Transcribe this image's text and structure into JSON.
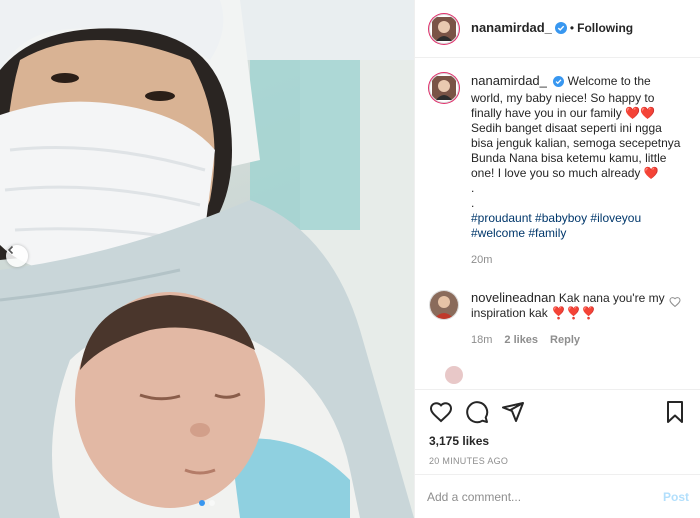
{
  "post": {
    "username": "nanamirdad_",
    "follow_status": "Following",
    "separator": "•"
  },
  "caption": {
    "username": "nanamirdad_",
    "line1": "Welcome to the world, my baby niece! So happy to finally have you in our family",
    "hearts1": "❤️❤️",
    "line2": "Sedih banget disaat seperti ini ngga bisa jenguk kalian, semoga secepetnya Bunda Nana bisa ketemu kamu, little one! I love you so much already",
    "hearts2": "❤️",
    "dot1": ".",
    "dot2": ".",
    "hashtags": "#proudaunt #babyboy #iloveyou #welcome #family",
    "time": "20m"
  },
  "comments": [
    {
      "username": "novelineadnan",
      "text": "Kak nana you're my inspiration kak",
      "emoji": "❣️❣️❣️",
      "time": "18m",
      "likes": "2 likes",
      "reply": "Reply"
    }
  ],
  "engagement": {
    "likes": "3,175 likes",
    "posted": "20 MINUTES AGO"
  },
  "comment_box": {
    "placeholder": "Add a comment...",
    "post_label": "Post"
  },
  "icons": {
    "like": "heart-icon",
    "comment": "comment-icon",
    "share": "share-icon",
    "save": "bookmark-icon",
    "verified": "verified-badge-icon",
    "prev": "chevron-left-icon"
  },
  "colors": {
    "link": "#00376b",
    "verified": "#3897f0",
    "post_disabled": "#b2dffc",
    "muted": "#8e8e8e"
  },
  "carousel": {
    "slides": 2,
    "active": 1
  }
}
